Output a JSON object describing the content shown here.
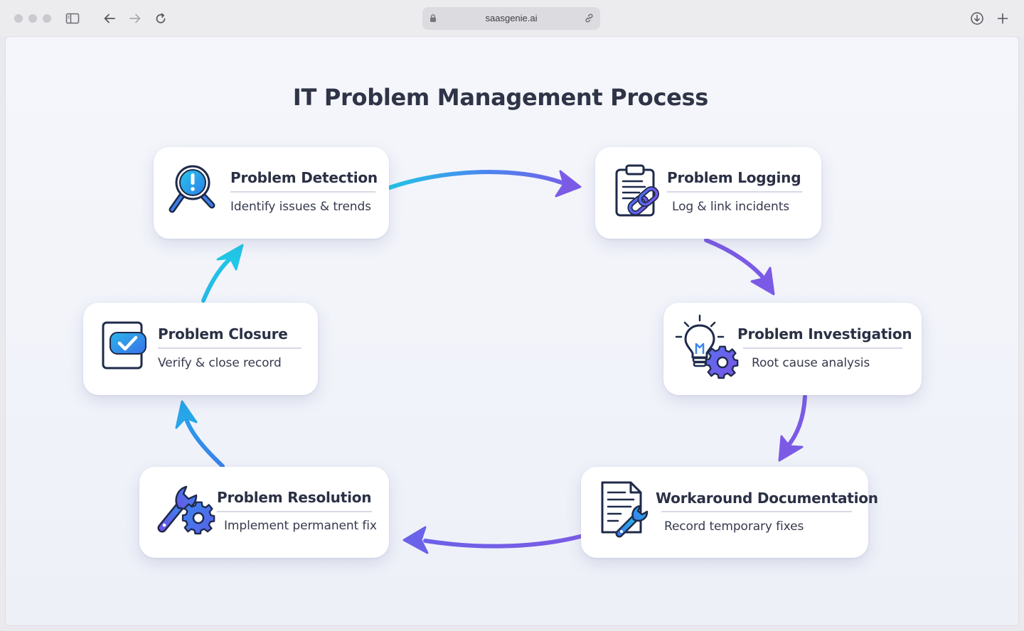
{
  "browser": {
    "url": "saasgenie.ai"
  },
  "diagram": {
    "title": "IT Problem Management Process",
    "steps": [
      {
        "title": "Problem Detection",
        "subtitle": "Identify issues & trends",
        "icon": "magnifier-alert-icon"
      },
      {
        "title": "Problem Logging",
        "subtitle": "Log & link incidents",
        "icon": "clipboard-link-icon"
      },
      {
        "title": "Problem Investigation",
        "subtitle": "Root cause analysis",
        "icon": "lightbulb-gear-icon"
      },
      {
        "title": "Workaround Documentation",
        "subtitle": "Record temporary fixes",
        "icon": "document-wrench-icon"
      },
      {
        "title": "Problem Resolution",
        "subtitle": "Implement permanent fix",
        "icon": "wrench-gear-icon"
      },
      {
        "title": "Problem Closure",
        "subtitle": "Verify & close record",
        "icon": "checkbox-icon"
      }
    ],
    "colors": {
      "cyan": "#22c4e6",
      "blue": "#3a86ee",
      "purple": "#7b5be6",
      "navy": "#1f2a4a",
      "title": "#2f3447"
    }
  }
}
